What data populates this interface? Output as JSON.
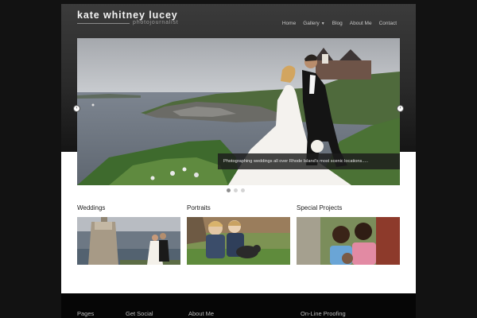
{
  "site": {
    "title": "kate whitney lucey",
    "subtitle": "photojournalist"
  },
  "nav": {
    "items": [
      {
        "label": "Home"
      },
      {
        "label": "Gallery",
        "has_dropdown": true
      },
      {
        "label": "Blog"
      },
      {
        "label": "About Me"
      },
      {
        "label": "Contact"
      }
    ]
  },
  "slider": {
    "caption": "Photographing weddings all over Rhode Island's most scenic locations.....",
    "slide_count": 3,
    "active_slide": 1,
    "prev_icon": "arrow-left-icon",
    "next_icon": "arrow-right-icon"
  },
  "sections": [
    {
      "title": "Weddings"
    },
    {
      "title": "Portraits"
    },
    {
      "title": "Special Projects"
    }
  ],
  "footer": {
    "items": [
      "Pages",
      "Get Social",
      "About Me",
      "On-Line Proofing"
    ]
  },
  "colors": {
    "page_background": "#121212",
    "header_top": "#3b3b3b",
    "content_background": "#ffffff",
    "footer_background": "#060606"
  }
}
